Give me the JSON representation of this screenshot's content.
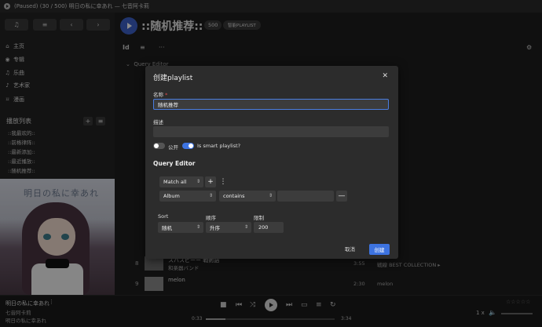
{
  "window": {
    "title": "(Paused) (30 / 500) 明日の私に幸あれ — 七音阿卡莉"
  },
  "nav": {
    "back": "‹",
    "forward": "›"
  },
  "sidebar": {
    "items": [
      {
        "icon": "⌂",
        "label": "主页"
      },
      {
        "icon": "◉",
        "label": "专辑"
      },
      {
        "icon": "♫",
        "label": "乐曲"
      },
      {
        "icon": "♪",
        "label": "艺术家"
      },
      {
        "icon": "⌑",
        "label": "漫画"
      }
    ],
    "playlists_header": "播放列表",
    "playlists": [
      "::我最欢的::",
      "::前格律阵::",
      "::最新添加::",
      "::最近播放::",
      "::随机推荐::"
    ],
    "cover_text": "明日の私に幸あれ"
  },
  "main": {
    "title": "::随机推荐::",
    "count": "500",
    "smart_badge": "智能PLAYLIST",
    "toolbar": {
      "id_label": "Id",
      "sort_icon": "≡",
      "more_icon": "···",
      "settings_icon": "⚙"
    },
    "query_editor_label": "Query Editor",
    "rows": [
      {
        "num": "8",
        "title": "スパスピーー 戦術語",
        "artist": "和楽器バンド",
        "duration": "3:55",
        "album": "戦線 BEST COLLECTION ▸"
      },
      {
        "num": "9",
        "title": "melon",
        "artist": "",
        "duration": "2:30",
        "album": "melon"
      }
    ]
  },
  "player": {
    "title": "明日の私に幸あれ",
    "artist": "七音阿卡莉",
    "album": "明日の私に幸あれ",
    "time_current": "0:33",
    "time_total": "3:34",
    "progress_fraction": 0.154,
    "rate": "1 x",
    "stars": "☆☆☆☆☆"
  },
  "dialog": {
    "title": "创建playlist",
    "name_label": "名称",
    "required_mark": "*",
    "name_value": "随机推荐",
    "desc_label": "描述",
    "desc_value": "",
    "public_label": "公开",
    "smart_label": "Is smart playlist?",
    "public_on": false,
    "smart_on": true,
    "query_editor": "Query Editor",
    "match_select": "Match all",
    "add_button": "+",
    "more_button": "⋮",
    "field_select": "Album",
    "operator_select": "contains",
    "rule_value": "",
    "remove_button": "—",
    "sort_label": "Sort",
    "order_label": "顺序",
    "limit_label": "限制",
    "sort_select": "随机",
    "order_select": "升序",
    "limit_value": "200",
    "cancel": "取消",
    "create": "创建"
  },
  "colors": {
    "accent": "#3d73e0",
    "background": "#1b1b1b",
    "dialog": "#2c2c2c"
  }
}
